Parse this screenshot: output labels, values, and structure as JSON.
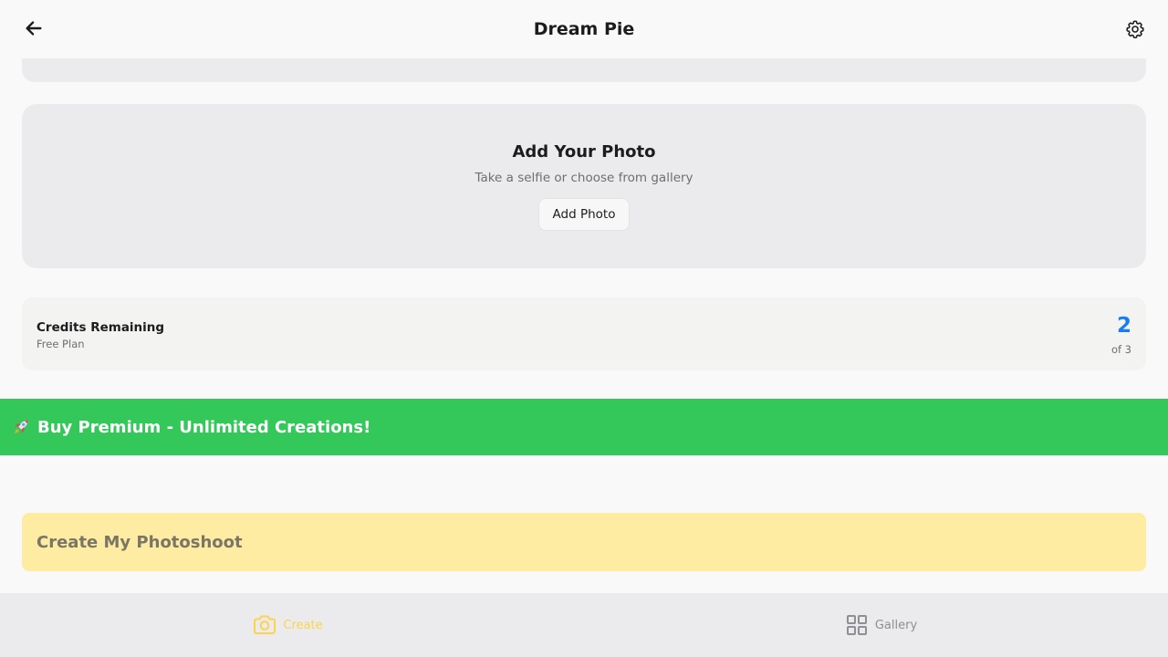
{
  "header": {
    "title": "Dream Pie",
    "back_icon": "arrow-left-icon",
    "settings_icon": "gear-icon"
  },
  "photo_card": {
    "title": "Add Your Photo",
    "subtitle": "Take a selfie or choose from gallery",
    "button_label": "Add Photo"
  },
  "credits": {
    "label": "Credits Remaining",
    "plan": "Free Plan",
    "count": "2",
    "total": "of 3",
    "accent": "#1a7cf5"
  },
  "premium_banner": {
    "icon": "rocket-icon",
    "label": "Buy Premium - Unlimited Creations!",
    "color": "#34c759"
  },
  "create_button": {
    "label": "Create My Photoshoot",
    "color": "#fdeca1"
  },
  "tabbar": {
    "tabs": [
      {
        "label": "Create",
        "icon": "camera-icon",
        "active": true,
        "color": "#fcd34d"
      },
      {
        "label": "Gallery",
        "icon": "grid-icon",
        "active": false,
        "color": "#8e8e93"
      }
    ]
  }
}
